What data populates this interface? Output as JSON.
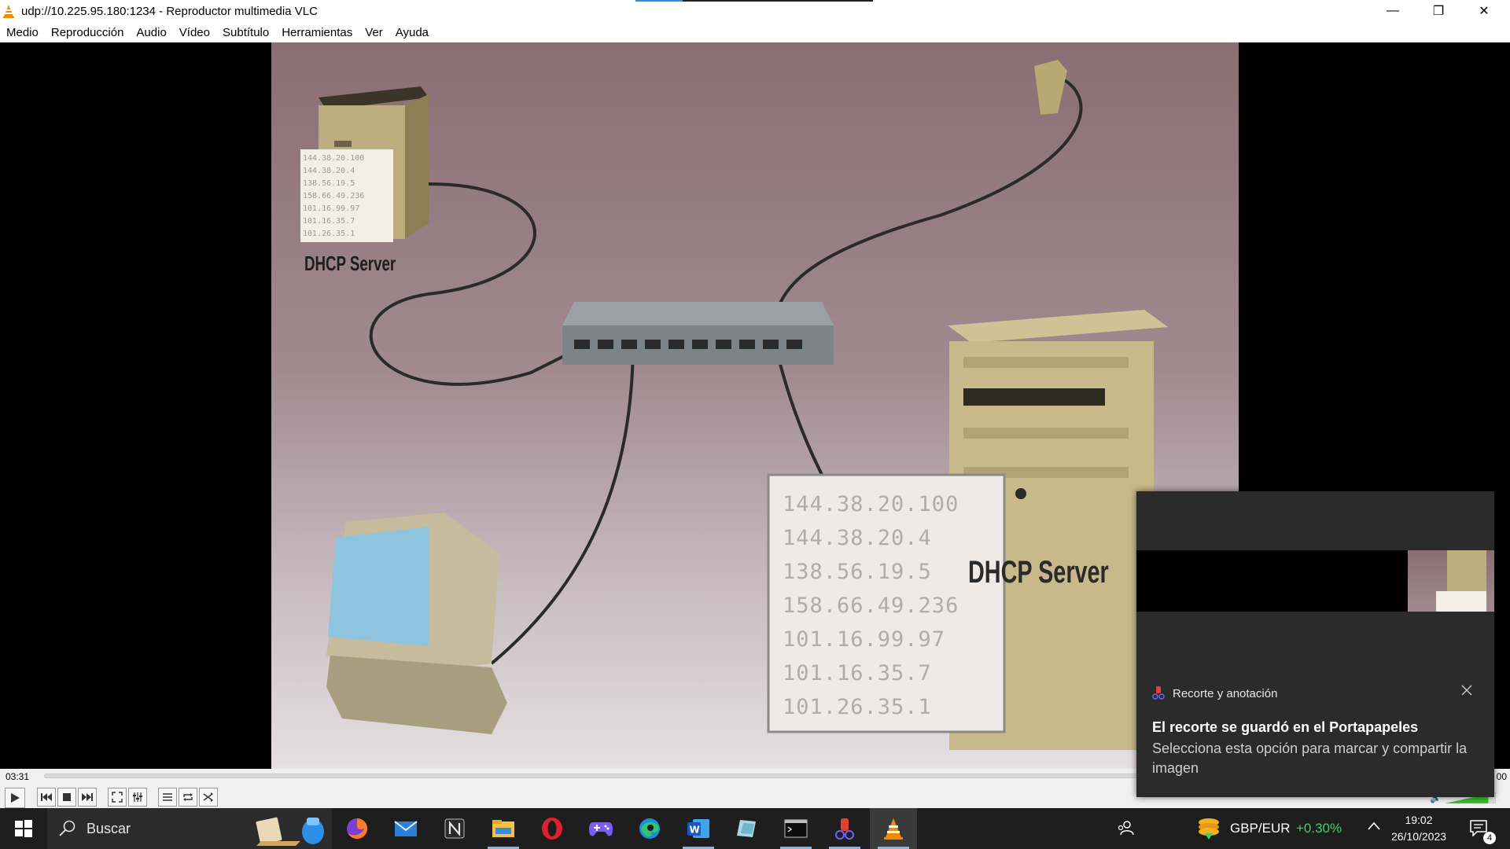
{
  "window": {
    "title": "udp://10.225.95.180:1234 - Reproductor multimedia VLC",
    "minimize": "—",
    "maximize": "❐",
    "close": "✕"
  },
  "menu": {
    "items": [
      "Medio",
      "Reproducción",
      "Audio",
      "Vídeo",
      "Subtítulo",
      "Herramientas",
      "Ver",
      "Ayuda"
    ]
  },
  "video": {
    "label_dhcp_small": "DHCP Server",
    "label_dhcp_large": "DHCP Server",
    "addresses_small": [
      "144.38.20.100",
      "144.38.20.4",
      "138.56.19.5",
      "158.66.49.236",
      "101.16.99.97",
      "101.16.35.7",
      "101.26.35.1"
    ],
    "addresses_large": [
      "144.38.20.100",
      "144.38.20.4",
      "138.56.19.5",
      "158.66.49.236",
      "101.16.99.97",
      "101.16.35.7",
      "101.26.35.1"
    ]
  },
  "controls": {
    "elapsed": "03:31",
    "total": "00",
    "seek_fraction": 0.0,
    "volume_fraction": 0.85
  },
  "taskbar": {
    "search_placeholder": "Buscar",
    "tray": {
      "currency_pair": "GBP/EUR",
      "currency_change": "+0.30%",
      "time": "19:02",
      "date": "26/10/2023",
      "notifications": "4"
    }
  },
  "toast": {
    "app_name": "Recorte y anotación",
    "title": "El recorte se guardó en el Portapapeles",
    "body": "Selecciona esta opción para marcar y compartir la imagen"
  },
  "colors": {
    "vlc_orange": "#f08a00",
    "accent_blue": "#2b8de6",
    "tray_green": "#3fd16f"
  }
}
